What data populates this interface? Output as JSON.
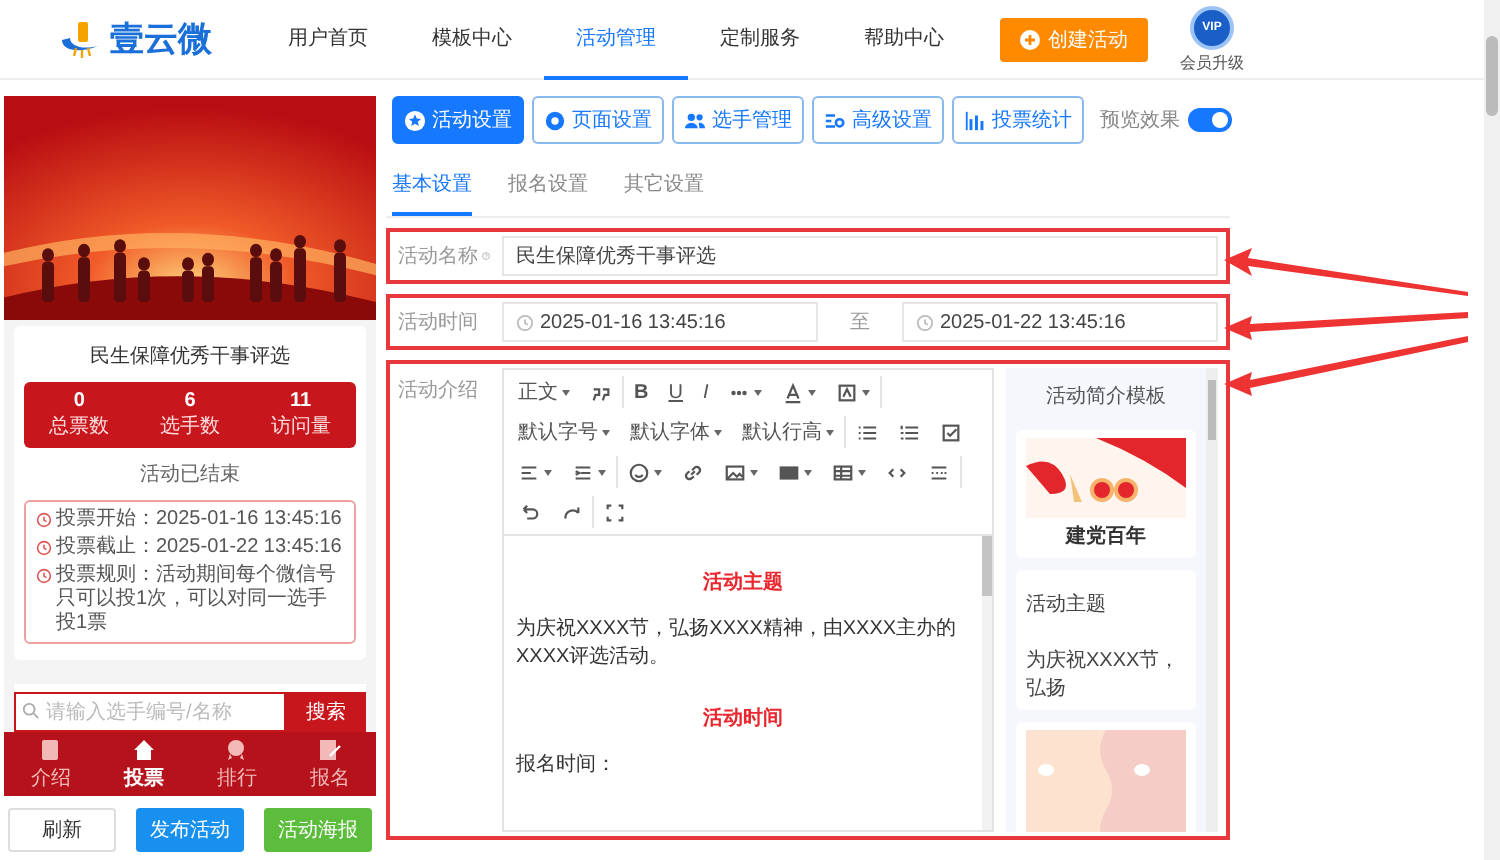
{
  "nav": {
    "logo": "壹云微",
    "items": [
      {
        "label": "用户首页",
        "selected": false
      },
      {
        "label": "模板中心",
        "selected": false
      },
      {
        "label": "活动管理",
        "selected": true
      },
      {
        "label": "定制服务",
        "selected": false
      },
      {
        "label": "帮助中心",
        "selected": false
      }
    ],
    "create_button": "创建活动",
    "vip_badge": "VIP",
    "vip_label": "会员升级"
  },
  "preview": {
    "title": "民生保障优秀干事评选",
    "stats": [
      {
        "value": "0",
        "label": "总票数"
      },
      {
        "value": "6",
        "label": "选手数"
      },
      {
        "value": "11",
        "label": "访问量"
      }
    ],
    "status": "活动已结束",
    "info": [
      {
        "label": "投票开始：",
        "value": "2025-01-16 13:45:16"
      },
      {
        "label": "投票截止：",
        "value": "2025-01-22 13:45:16"
      },
      {
        "label": "投票规则：",
        "value": "活动期间每个微信号只可以投1次，可以对同一选手投1票"
      }
    ],
    "search": {
      "placeholder": "请输入选手编号/名称",
      "button": "搜索"
    },
    "tabs": [
      {
        "label": "介绍",
        "selected": false
      },
      {
        "label": "投票",
        "selected": true
      },
      {
        "label": "排行",
        "selected": false
      },
      {
        "label": "报名",
        "selected": false
      }
    ]
  },
  "actions": [
    {
      "label": "刷新",
      "kind": "plain"
    },
    {
      "label": "发布活动",
      "kind": "primary"
    },
    {
      "label": "活动海报",
      "kind": "success"
    }
  ],
  "toolbar": [
    {
      "label": "活动设置",
      "selected": true
    },
    {
      "label": "页面设置",
      "selected": false
    },
    {
      "label": "选手管理",
      "selected": false
    },
    {
      "label": "高级设置",
      "selected": false
    },
    {
      "label": "投票统计",
      "selected": false
    }
  ],
  "preview_toggle": {
    "label": "预览效果",
    "on": true
  },
  "subtabs": [
    {
      "label": "基本设置",
      "selected": true
    },
    {
      "label": "报名设置",
      "selected": false
    },
    {
      "label": "其它设置",
      "selected": false
    }
  ],
  "form": {
    "name": {
      "label": "活动名称",
      "value": "民生保障优秀干事评选"
    },
    "time": {
      "label": "活动时间",
      "start": "2025-01-16 13:45:16",
      "separator": "至",
      "end": "2025-01-22 13:45:16"
    },
    "intro": {
      "label": "活动介绍"
    }
  },
  "editor": {
    "toolbar_labels": [
      "正文",
      "B",
      "U",
      "I",
      "默认字号",
      "默认字体",
      "默认行高"
    ],
    "content": [
      {
        "kind": "heading",
        "text": "活动主题"
      },
      {
        "kind": "paragraph",
        "text": "为庆祝XXXX节，弘扬XXXX精神，由XXXX主办的XXXX评选活动。"
      },
      {
        "kind": "heading",
        "text": "活动时间"
      },
      {
        "kind": "paragraph",
        "text": "报名时间："
      }
    ]
  },
  "templates": {
    "title": "活动简介模板",
    "cards": [
      {
        "kind": "picture",
        "caption": "建党百年"
      },
      {
        "kind": "text",
        "title": "活动主题",
        "text": "为庆祝XXXX节，弘扬"
      },
      {
        "kind": "picture"
      }
    ]
  }
}
